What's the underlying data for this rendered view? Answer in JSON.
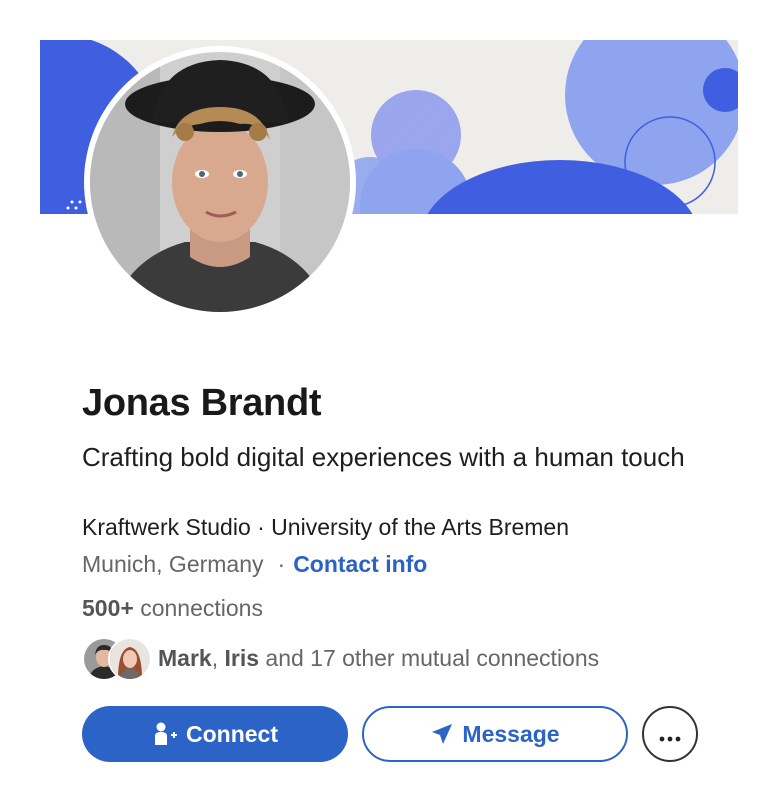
{
  "profile": {
    "name": "Jonas Brandt",
    "headline": "Crafting bold digital experiences with a human touch",
    "org": "Kraftwerk Studio · University of the Arts Bremen",
    "location": "Munich, Germany",
    "separator": "·",
    "contact_label": "Contact info"
  },
  "connections": {
    "count": "500+",
    "label": "connections"
  },
  "mutual": {
    "name1": "Mark",
    "sep": ", ",
    "name2": "Iris",
    "rest": " and 17 other mutual connections"
  },
  "actions": {
    "connect_label": "Connect",
    "message_label": "Message",
    "more_label": "···"
  },
  "colors": {
    "accent": "#2c63c6",
    "banner_bg": "#efedea",
    "banner_blue": "#3f5fe0",
    "banner_light": "#8ea4ee"
  },
  "icons": {
    "connect": "person-add-icon",
    "message": "paper-plane-icon",
    "more": "ellipsis-icon"
  }
}
